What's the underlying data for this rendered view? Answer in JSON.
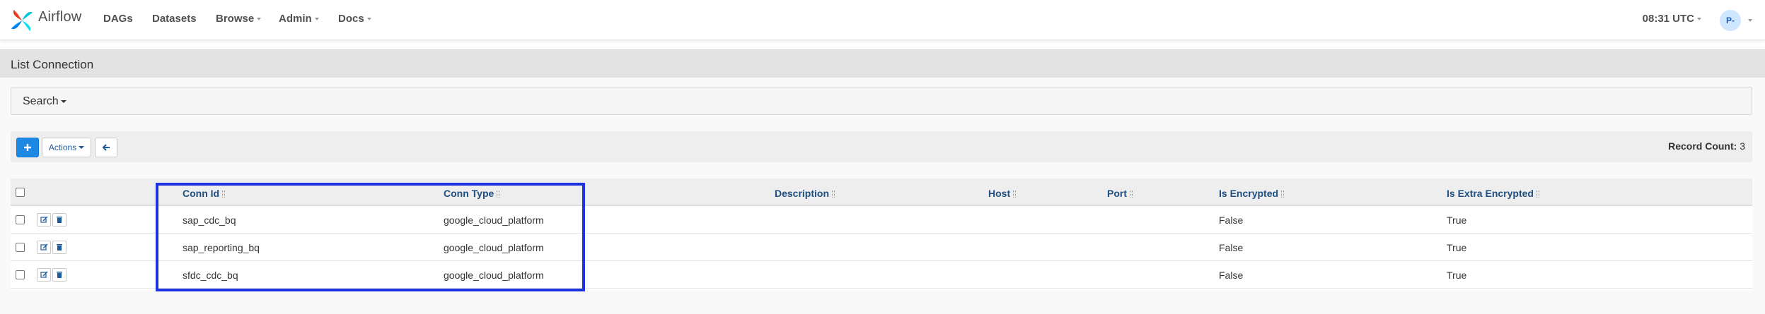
{
  "brand": {
    "name": "Airflow"
  },
  "nav": {
    "items": [
      {
        "label": "DAGs",
        "dropdown": false
      },
      {
        "label": "Datasets",
        "dropdown": false
      },
      {
        "label": "Browse",
        "dropdown": true
      },
      {
        "label": "Admin",
        "dropdown": true
      },
      {
        "label": "Docs",
        "dropdown": true
      }
    ],
    "clock": "08:31 UTC",
    "user_initials": "P-"
  },
  "page": {
    "title": "List Connection",
    "search_label": "Search",
    "actions_label": "Actions",
    "record_count_label": "Record Count:",
    "record_count": "3"
  },
  "table": {
    "columns": [
      {
        "key": "conn_id",
        "label": "Conn Id"
      },
      {
        "key": "conn_type",
        "label": "Conn Type"
      },
      {
        "key": "description",
        "label": "Description"
      },
      {
        "key": "host",
        "label": "Host"
      },
      {
        "key": "port",
        "label": "Port"
      },
      {
        "key": "is_encrypted",
        "label": "Is Encrypted"
      },
      {
        "key": "is_extra_encrypted",
        "label": "Is Extra Encrypted"
      }
    ],
    "rows": [
      {
        "conn_id": "sap_cdc_bq",
        "conn_type": "google_cloud_platform",
        "description": "",
        "host": "",
        "port": "",
        "is_encrypted": "False",
        "is_extra_encrypted": "True"
      },
      {
        "conn_id": "sap_reporting_bq",
        "conn_type": "google_cloud_platform",
        "description": "",
        "host": "",
        "port": "",
        "is_encrypted": "False",
        "is_extra_encrypted": "True"
      },
      {
        "conn_id": "sfdc_cdc_bq",
        "conn_type": "google_cloud_platform",
        "description": "",
        "host": "",
        "port": "",
        "is_encrypted": "False",
        "is_extra_encrypted": "True"
      }
    ]
  },
  "icons": {
    "add": "plus-icon",
    "back": "arrow-left-icon",
    "edit": "edit-icon",
    "delete": "trash-icon"
  },
  "colors": {
    "primary": "#1e88e5",
    "highlight": "#1d33e0",
    "header_text": "#1e4f80"
  }
}
